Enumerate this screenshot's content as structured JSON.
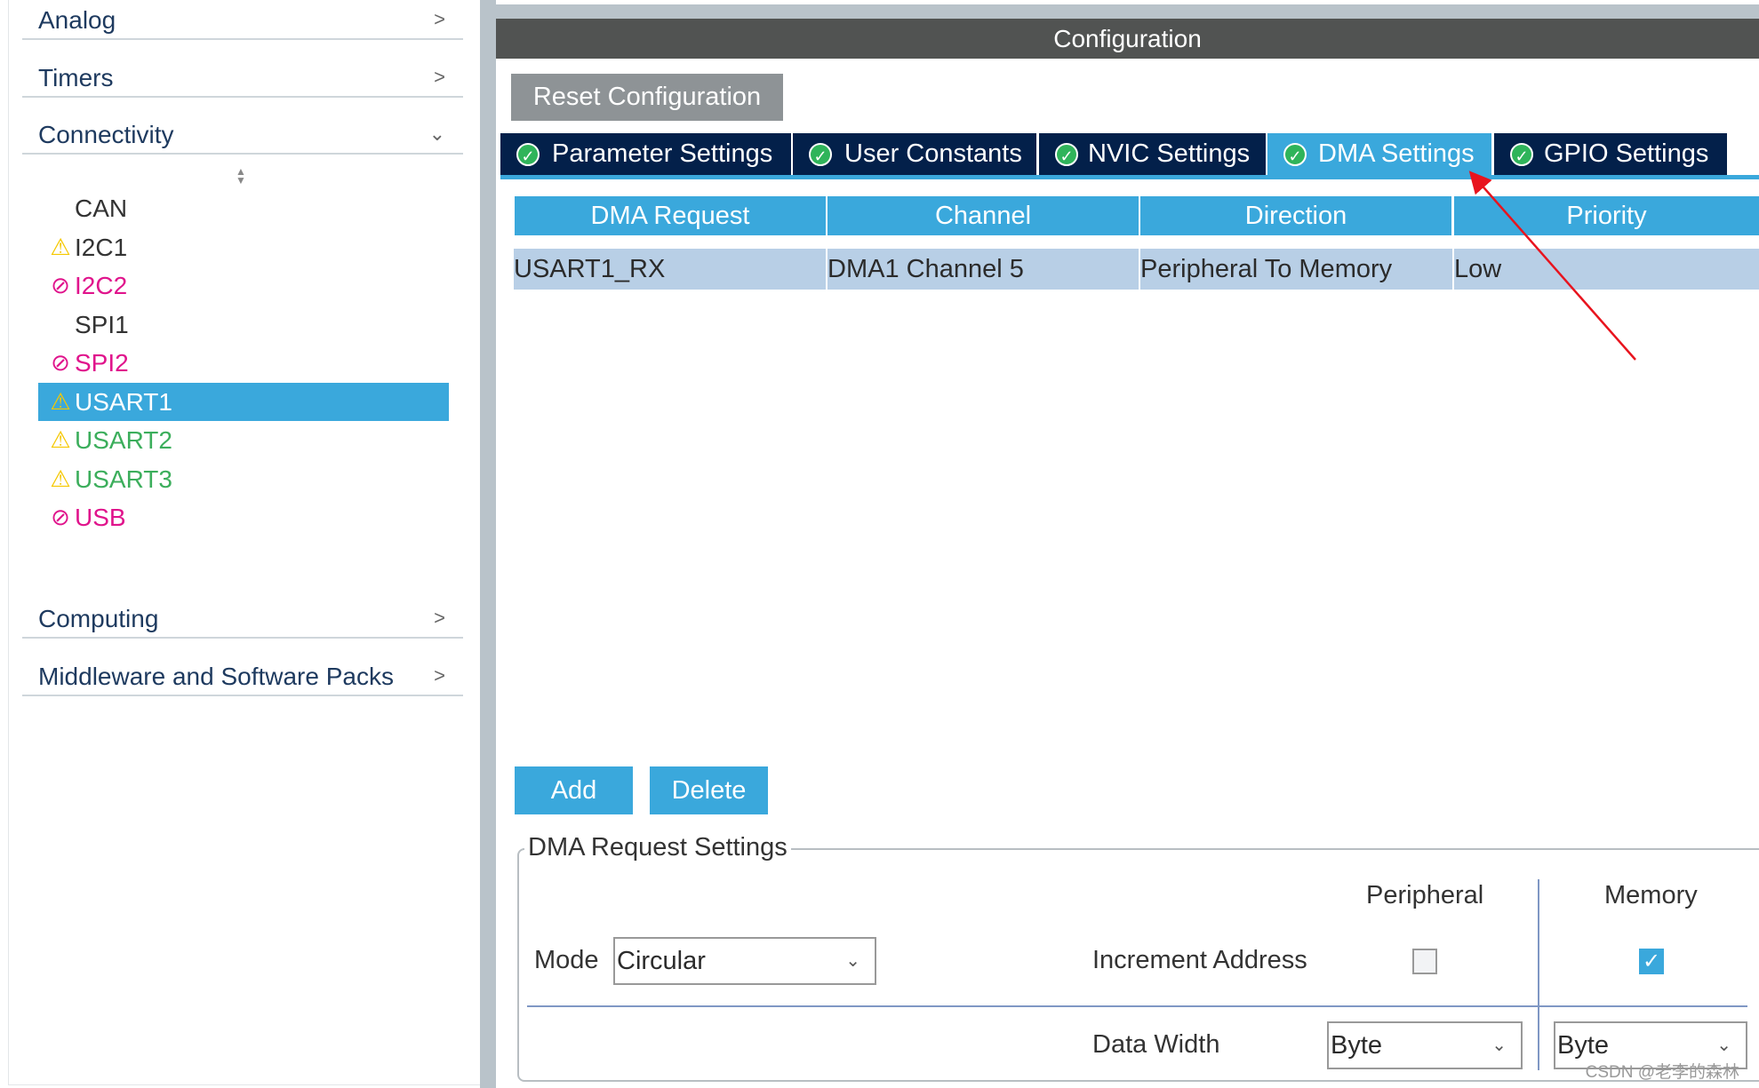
{
  "sidebar": {
    "categories": [
      {
        "label": "Analog",
        "expanded": false
      },
      {
        "label": "Timers",
        "expanded": false
      },
      {
        "label": "Connectivity",
        "expanded": true
      },
      {
        "label": "Computing",
        "expanded": false
      },
      {
        "label": "Middleware and Software Packs",
        "expanded": false
      }
    ],
    "items": [
      {
        "label": "CAN",
        "status": "none",
        "color": "#333333"
      },
      {
        "label": "I2C1",
        "status": "warning",
        "color": "#333333"
      },
      {
        "label": "I2C2",
        "status": "disabled",
        "color": "#e0148c"
      },
      {
        "label": "SPI1",
        "status": "none",
        "color": "#333333"
      },
      {
        "label": "SPI2",
        "status": "disabled",
        "color": "#e0148c"
      },
      {
        "label": "USART1",
        "status": "warning",
        "color": "#ffffff",
        "selected": true
      },
      {
        "label": "USART2",
        "status": "warning",
        "color": "#3cae5c"
      },
      {
        "label": "USART3",
        "status": "warning",
        "color": "#3cae5c"
      },
      {
        "label": "USB",
        "status": "disabled",
        "color": "#e0148c"
      }
    ]
  },
  "config": {
    "title": "Configuration",
    "reset_label": "Reset Configuration",
    "tabs": [
      {
        "label": "Parameter Settings"
      },
      {
        "label": "User Constants"
      },
      {
        "label": "NVIC Settings"
      },
      {
        "label": "DMA Settings",
        "active": true
      },
      {
        "label": "GPIO Settings"
      }
    ],
    "table": {
      "headers": [
        "DMA Request",
        "Channel",
        "Direction",
        "Priority"
      ],
      "rows": [
        [
          "USART1_RX",
          "DMA1 Channel 5",
          "Peripheral To Memory",
          "Low"
        ]
      ]
    },
    "add_label": "Add",
    "delete_label": "Delete",
    "settings": {
      "legend": "DMA Request Settings",
      "mode_label": "Mode",
      "mode_value": "Circular",
      "peripheral_header": "Peripheral",
      "memory_header": "Memory",
      "increment_label": "Increment Address",
      "increment_peripheral": false,
      "increment_memory": true,
      "data_width_label": "Data Width",
      "data_width_peripheral": "Byte",
      "data_width_memory": "Byte"
    }
  },
  "watermark": "CSDN @老李的森林",
  "colors": {
    "accent": "#3aa8dc",
    "tab_bg": "#03204a",
    "header_bg": "#515352",
    "row_bg": "#b8cfe6",
    "annotation_arrow": "#e8141e"
  }
}
